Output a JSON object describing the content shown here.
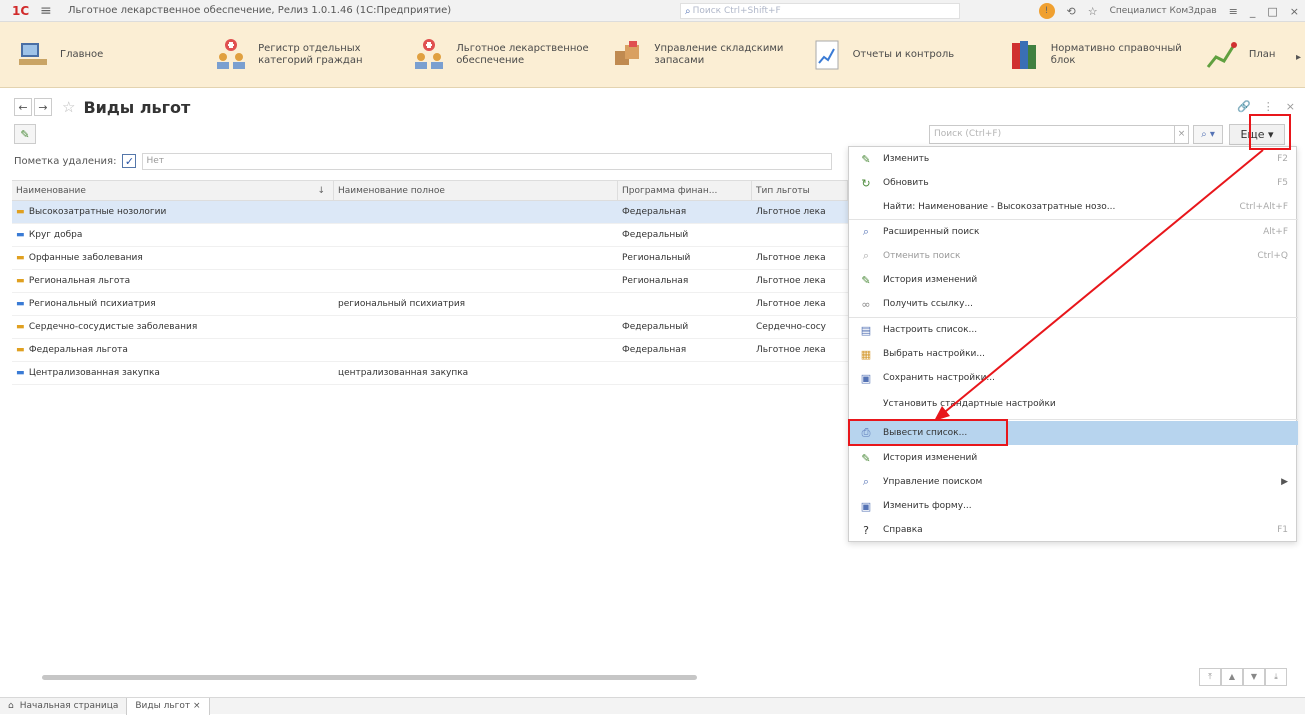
{
  "window": {
    "title": "Льготное лекарственное обеспечение, Релиз 1.0.1.46  (1С:Предприятие)",
    "search_placeholder": "Поиск Ctrl+Shift+F",
    "user": "Специалист КомЗдрав"
  },
  "sections": [
    {
      "label": "Главное",
      "icon": "home-desk-icon"
    },
    {
      "label": "Регистр отдельных категорий граждан",
      "icon": "people-registry-icon"
    },
    {
      "label": "Льготное лекарственное обеспечение",
      "icon": "people-medical-icon"
    },
    {
      "label": "Управление складскими запасами",
      "icon": "warehouse-icon"
    },
    {
      "label": "Отчеты и контроль",
      "icon": "reports-icon"
    },
    {
      "label": "Нормативно справочный блок",
      "icon": "books-icon"
    },
    {
      "label": "План",
      "icon": "chart-icon"
    }
  ],
  "page": {
    "title": "Виды льгот",
    "search_placeholder": "Поиск (Ctrl+F)",
    "more_label": "Еще",
    "filter_label": "Пометка удаления:",
    "filter_value": "Нет"
  },
  "grid": {
    "columns": [
      "Наименование",
      "Наименование полное",
      "Программа финан...",
      "Тип льготы"
    ],
    "rows": [
      {
        "name": "Высокозатратные нозологии",
        "full": "",
        "program": "Федеральная",
        "type": "Льготное лека",
        "icon": "gold"
      },
      {
        "name": "Круг добра",
        "full": "",
        "program": "Федеральный",
        "type": "",
        "icon": "blue"
      },
      {
        "name": "Орфанные заболевания",
        "full": "",
        "program": "Региональный",
        "type": "Льготное лека",
        "icon": "gold"
      },
      {
        "name": "Региональная льгота",
        "full": "",
        "program": "Региональная",
        "type": "Льготное лека",
        "icon": "gold"
      },
      {
        "name": "Региональный психиатрия",
        "full": "региональный психиатрия",
        "program": "",
        "type": "Льготное лека",
        "icon": "blue"
      },
      {
        "name": "Сердечно-сосудистые заболевания",
        "full": "",
        "program": "Федеральный",
        "type": "Сердечно-сосу",
        "icon": "gold"
      },
      {
        "name": "Федеральная льгота",
        "full": "",
        "program": "Федеральная",
        "type": "Льготное лека",
        "icon": "gold"
      },
      {
        "name": "Централизованная закупка",
        "full": "централизованная закупка",
        "program": "",
        "type": "",
        "icon": "blue"
      }
    ]
  },
  "menu": [
    {
      "label": "Изменить",
      "shortcut": "F2",
      "icon": "pencil-icon"
    },
    {
      "label": "Обновить",
      "shortcut": "F5",
      "icon": "refresh-icon"
    },
    {
      "label": "Найти: Наименование - Высокозатратные нозо...",
      "shortcut": "Ctrl+Alt+F",
      "icon": ""
    },
    {
      "label": "Расширенный поиск",
      "shortcut": "Alt+F",
      "icon": "search-icon"
    },
    {
      "label": "Отменить поиск",
      "shortcut": "Ctrl+Q",
      "icon": "cancel-search-icon"
    },
    {
      "label": "История изменений",
      "shortcut": "",
      "icon": "history-icon"
    },
    {
      "label": "Получить ссылку...",
      "shortcut": "",
      "icon": "link-icon"
    },
    {
      "label": "Настроить список...",
      "shortcut": "",
      "icon": "settings-list-icon"
    },
    {
      "label": "Выбрать настройки...",
      "shortcut": "",
      "icon": "choose-settings-icon"
    },
    {
      "label": "Сохранить настройки...",
      "shortcut": "",
      "icon": "save-settings-icon"
    },
    {
      "label": "Установить стандартные настройки",
      "shortcut": "",
      "icon": ""
    },
    {
      "label": "Вывести список...",
      "shortcut": "",
      "icon": "print-list-icon"
    },
    {
      "label": "История изменений",
      "shortcut": "",
      "icon": "history-icon"
    },
    {
      "label": "Управление поиском",
      "shortcut": "",
      "icon": "search-manage-icon"
    },
    {
      "label": "Изменить форму...",
      "shortcut": "",
      "icon": "form-icon"
    },
    {
      "label": "Справка",
      "shortcut": "F1",
      "icon": "help-icon"
    }
  ],
  "tabs": [
    {
      "label": "Начальная страница"
    },
    {
      "label": "Виды льгот ×"
    }
  ]
}
